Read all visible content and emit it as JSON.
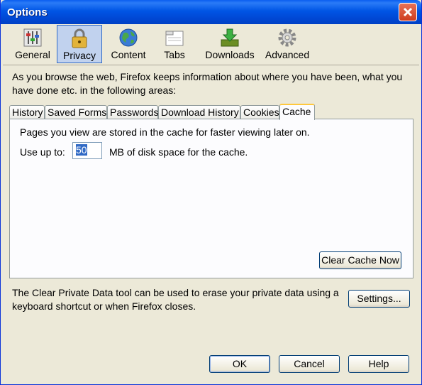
{
  "window": {
    "title": "Options"
  },
  "toolbar": {
    "items": [
      {
        "label": "General",
        "icon": "general-icon"
      },
      {
        "label": "Privacy",
        "icon": "padlock-icon",
        "selected": true
      },
      {
        "label": "Content",
        "icon": "globe-icon"
      },
      {
        "label": "Tabs",
        "icon": "tabs-icon"
      },
      {
        "label": "Downloads",
        "icon": "downloads-icon"
      },
      {
        "label": "Advanced",
        "icon": "gear-icon"
      }
    ]
  },
  "privacy": {
    "intro": "As you browse the web, Firefox keeps information about where you have been, what you have done etc. in the following areas:",
    "tabs": [
      "History",
      "Saved Forms",
      "Passwords",
      "Download History",
      "Cookies",
      "Cache"
    ],
    "active_tab": "Cache",
    "cache": {
      "description": "Pages you view are stored in the cache for faster viewing later on.",
      "use_up_to_label": "Use up to:",
      "size_value": "50",
      "size_suffix": "MB of disk space for the cache.",
      "clear_button": "Clear Cache Now"
    },
    "clear_private_data": "The Clear Private Data tool can be used to erase your private data using a keyboard shortcut or when Firefox closes.",
    "settings_button": "Settings..."
  },
  "footer": {
    "ok": "OK",
    "cancel": "Cancel",
    "help": "Help"
  },
  "colors": {
    "titlebar": "#0055e5",
    "selected_tab_accent": "#ffc83c",
    "selection": "#316ac5"
  }
}
